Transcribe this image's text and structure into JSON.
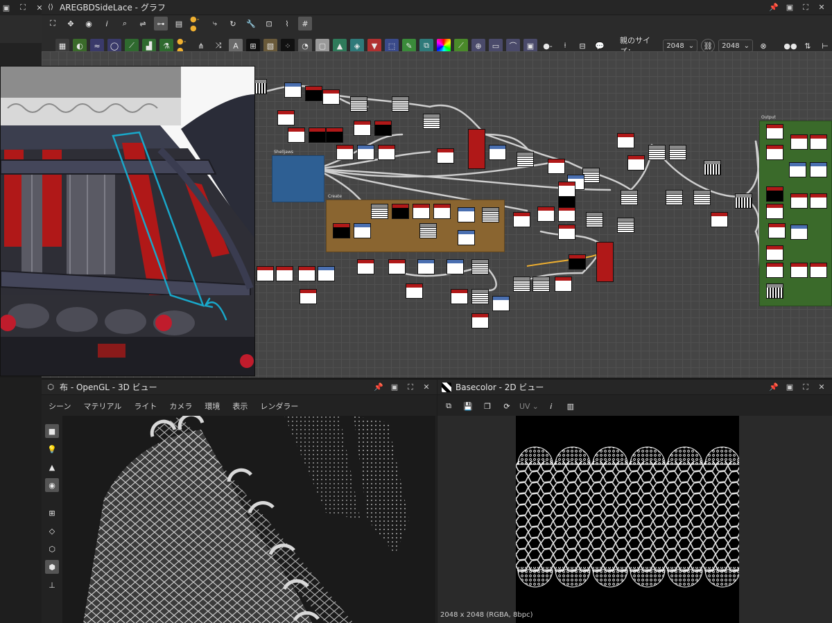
{
  "graph_window": {
    "title": "AREGBDSideLace - グラフ",
    "parent_size_label": "親のサイズ：",
    "size_w": "2048",
    "size_h": "2048",
    "frame_labels": [
      "Output",
      "Shelljaws",
      "Create"
    ]
  },
  "view3d": {
    "title": "布 - OpenGL - 3D ビュー",
    "menu": [
      "シーン",
      "マテリアル",
      "ライト",
      "カメラ",
      "環境",
      "表示",
      "レンダラー"
    ]
  },
  "view2d": {
    "title": "Basecolor - 2D ビュー",
    "uv_label": "UV",
    "status": "2048 x 2048 (RGBA, 8bpc)"
  },
  "colors": {
    "node_red": "#b01818",
    "node_blue": "#4a6fb0",
    "node_gray": "#8a8a8a",
    "frame_blue": "#2e5f93",
    "frame_brown": "#8a6530",
    "frame_green": "#3a6a2a",
    "annotation": "#19a7c9"
  }
}
